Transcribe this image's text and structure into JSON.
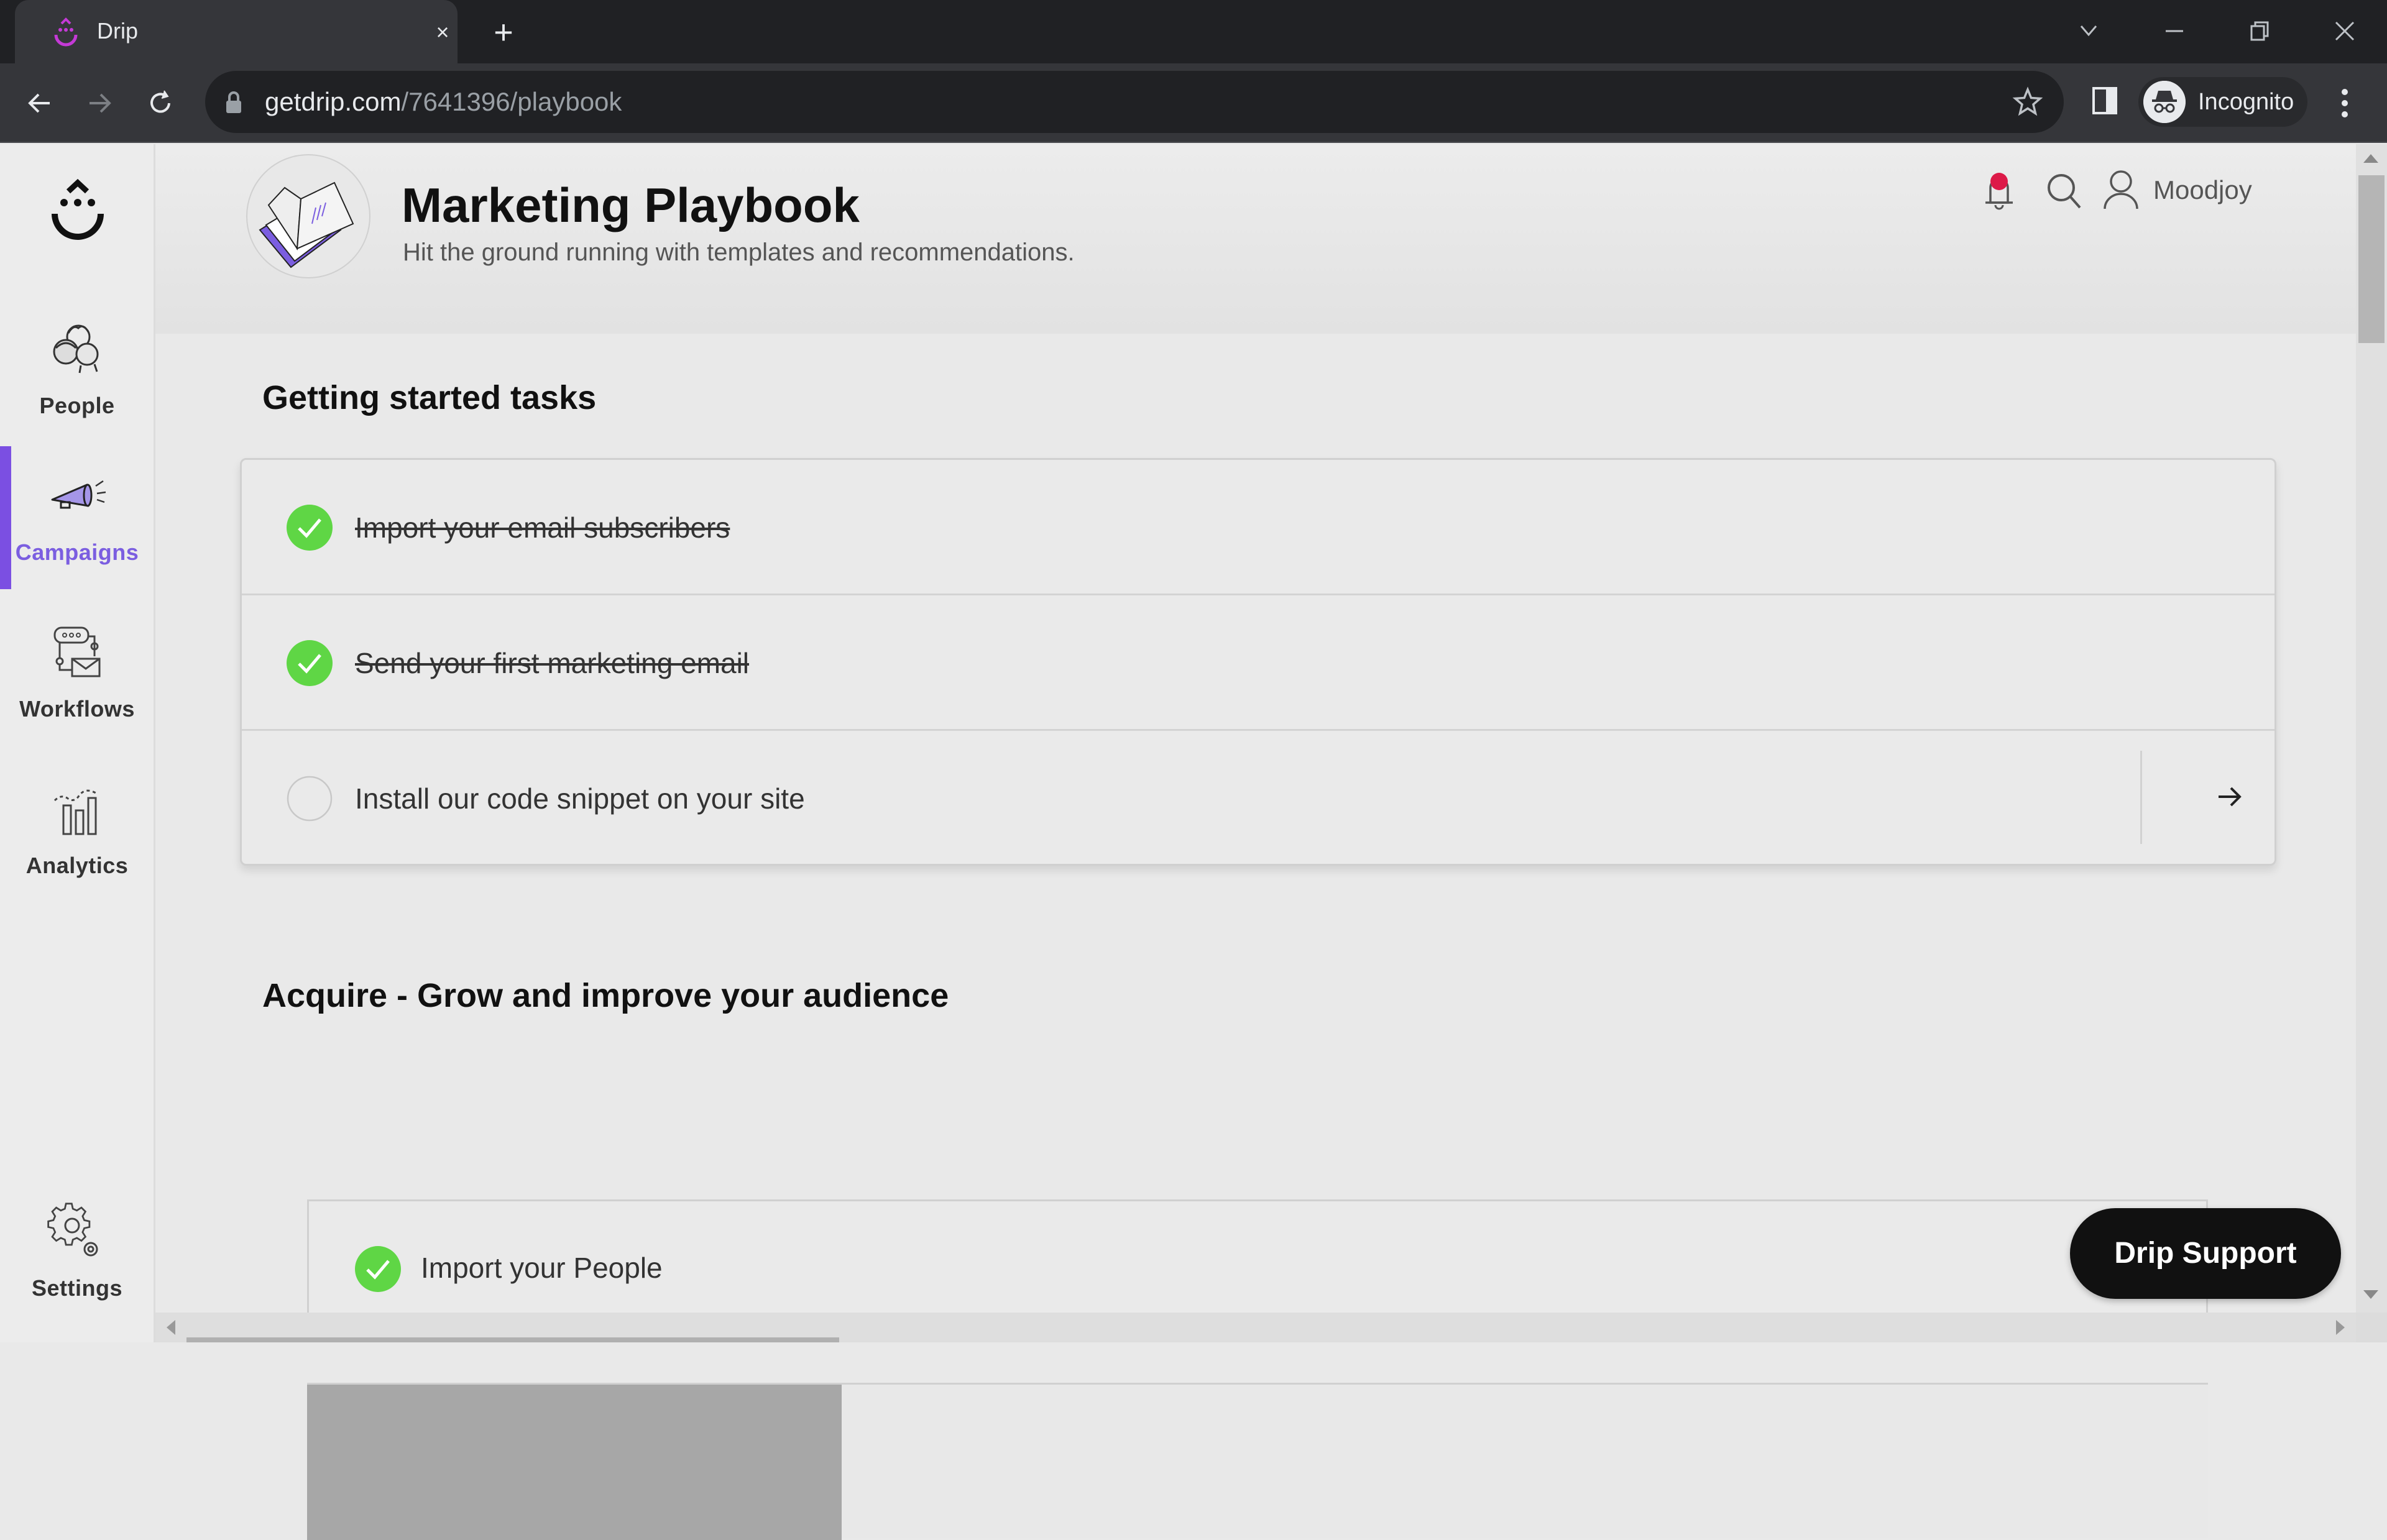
{
  "browser": {
    "tab_title": "Drip",
    "tab_close": "×",
    "new_tab": "+",
    "url_host": "getdrip.com",
    "url_path": "/7641396/playbook",
    "profile_label": "Incognito"
  },
  "sidebar": {
    "items": [
      {
        "label": "People",
        "icon": "people-icon",
        "active": false
      },
      {
        "label": "Campaigns",
        "icon": "megaphone-icon",
        "active": true
      },
      {
        "label": "Workflows",
        "icon": "workflow-icon",
        "active": false
      },
      {
        "label": "Analytics",
        "icon": "analytics-icon",
        "active": false
      },
      {
        "label": "Settings",
        "icon": "gear-icon",
        "active": false
      }
    ]
  },
  "header": {
    "title": "Marketing Playbook",
    "subtitle": "Hit the ground running with templates and recommendations.",
    "username": "Moodjoy",
    "notification_dot": true
  },
  "getting_started": {
    "title": "Getting started tasks",
    "tasks": [
      {
        "label": "Import your email subscribers",
        "completed": true
      },
      {
        "label": "Send your first marketing email",
        "completed": true
      },
      {
        "label": "Install our code snippet on your site",
        "completed": false
      }
    ]
  },
  "acquire": {
    "title": "Acquire - Grow and improve your audience",
    "tasks": [
      {
        "label": "Import your People",
        "completed": true
      }
    ]
  },
  "support_button": "Drip Support",
  "colors": {
    "accent": "#7b4fe2",
    "success": "#5fd645",
    "notification": "#dc1a48"
  }
}
